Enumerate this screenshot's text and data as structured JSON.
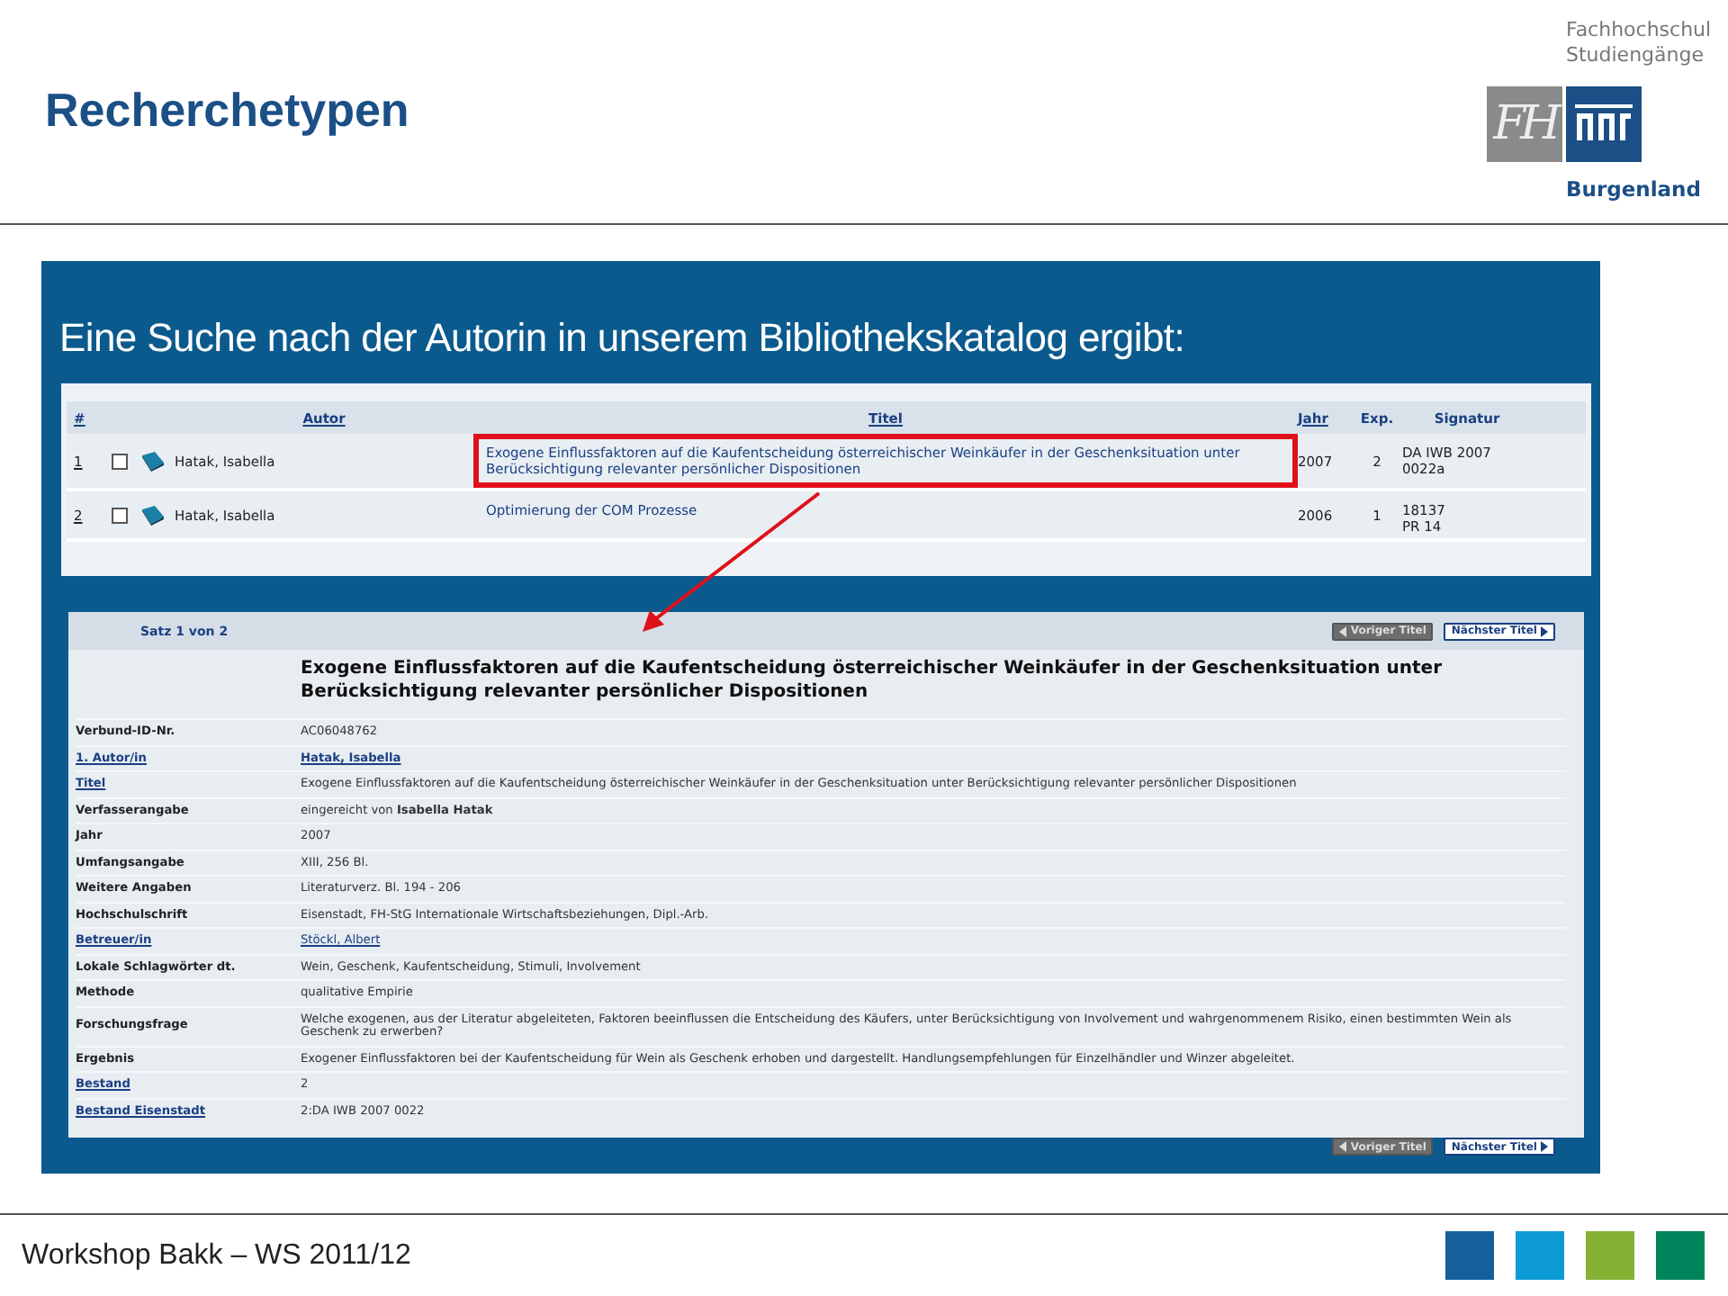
{
  "slide": {
    "title": "Recherchetypen"
  },
  "logo": {
    "lines": [
      "Fachhochschul",
      "Studiengänge"
    ],
    "mark": "FH",
    "place": "Burgenland"
  },
  "panel_heading": "Eine Suche nach der Autorin in unserem Bibliothekskatalog ergibt:",
  "results_table": {
    "columns": [
      {
        "label": "#",
        "link": true
      },
      {
        "label": "Autor",
        "link": true
      },
      {
        "label": "Titel",
        "link": true
      },
      {
        "label": "Jahr",
        "link": true
      },
      {
        "label": "Exp.",
        "link": false
      },
      {
        "label": "Signatur",
        "link": false
      }
    ],
    "rows": [
      {
        "number": "1",
        "checked": false,
        "author": "Hatak, Isabella",
        "title": "Exogene Einflussfaktoren auf die Kaufentscheidung österreichischer Weinkäufer in der Geschenksituation unter Berücksichtigung relevanter persönlicher Dispositionen",
        "year": "2007",
        "copies": "2",
        "signature": [
          "DA IWB 2007",
          "0022a"
        ],
        "highlighted": true
      },
      {
        "number": "2",
        "checked": false,
        "author": "Hatak, Isabella",
        "title": "Optimierung der COM Prozesse",
        "year": "2006",
        "copies": "1",
        "signature": [
          "18137",
          "PR 14"
        ],
        "highlighted": false
      }
    ]
  },
  "record": {
    "position": "Satz 1 von 2",
    "nav_top": [
      {
        "label": "Voriger Titel",
        "disabled": true,
        "kind": "prev"
      },
      {
        "label": "Nächster Titel",
        "disabled": false,
        "kind": "next"
      }
    ],
    "title": "Exogene Einflussfaktoren auf die Kaufentscheidung österreichischer Weinkäufer in der Geschenksituation unter Berücksichtigung relevanter persönlicher Dispositionen",
    "fields": [
      {
        "label": "Verbund-ID-Nr.",
        "label_link": false,
        "value": "AC06048762",
        "value_link": false
      },
      {
        "label": "1. Autor/in",
        "label_link": true,
        "value": "Hatak, Isabella",
        "value_link": true
      },
      {
        "label": "Titel",
        "label_link": true,
        "value": "Exogene Einflussfaktoren auf die Kaufentscheidung österreichischer Weinkäufer in der Geschenksituation unter Berücksichtigung relevanter persönlicher Dispositionen",
        "value_link": false
      },
      {
        "label": "Verfasserangabe",
        "label_link": false,
        "value": "eingereicht von **Isabella Hatak**",
        "value_link": false
      },
      {
        "label": "Jahr",
        "label_link": false,
        "value": "2007",
        "value_link": false
      },
      {
        "label": "Umfangsangabe",
        "label_link": false,
        "value": "XIII, 256 Bl.",
        "value_link": false
      },
      {
        "label": "Weitere Angaben",
        "label_link": false,
        "value": "Literaturverz. Bl. 194 - 206",
        "value_link": false
      },
      {
        "label": "Hochschulschrift",
        "label_link": false,
        "value": "Eisenstadt, FH-StG Internationale Wirtschaftsbeziehungen, Dipl.-Arb.",
        "value_link": false
      },
      {
        "label": "Betreuer/in",
        "label_link": true,
        "value": "Stöckl, Albert",
        "value_link": true
      },
      {
        "label": "Lokale Schlagwörter dt.",
        "label_link": false,
        "value": "Wein, Geschenk, Kaufentscheidung, Stimuli, Involvement",
        "value_link": false
      },
      {
        "label": "Methode",
        "label_link": false,
        "value": "qualitative Empirie",
        "value_link": false
      },
      {
        "label": "Forschungsfrage",
        "label_link": false,
        "value": "Welche exogenen, aus der Literatur abgeleiteten, Faktoren beeinflussen die Entscheidung des Käufers, unter Berücksichtigung von Involvement und wahrgenommenem Risiko, einen bestimmten Wein als Geschenk zu erwerben?",
        "value_link": false
      },
      {
        "label": "Ergebnis",
        "label_link": false,
        "value": "Exogener Einflussfaktoren bei der Kaufentscheidung für Wein als Geschenk erhoben und dargestellt. Handlungsempfehlungen für Einzelhändler und Winzer abgeleitet.",
        "value_link": false
      },
      {
        "label": "Bestand",
        "label_link": true,
        "value": "2",
        "value_link": false
      },
      {
        "label": "Bestand Eisenstadt",
        "label_link": true,
        "value": "2:DA IWB 2007 0022",
        "value_link": false
      }
    ],
    "nav_bottom": [
      {
        "label": "Voriger Titel",
        "disabled": true,
        "kind": "prev"
      },
      {
        "label": "Nächster Titel",
        "disabled": false,
        "kind": "next"
      }
    ]
  },
  "footer": {
    "text": "Workshop Bakk – WS 2011/12",
    "squares": [
      {
        "color": "#14609a"
      },
      {
        "color": "#0e9bd5"
      },
      {
        "color": "#86b234"
      },
      {
        "color": "#00845c"
      }
    ]
  }
}
